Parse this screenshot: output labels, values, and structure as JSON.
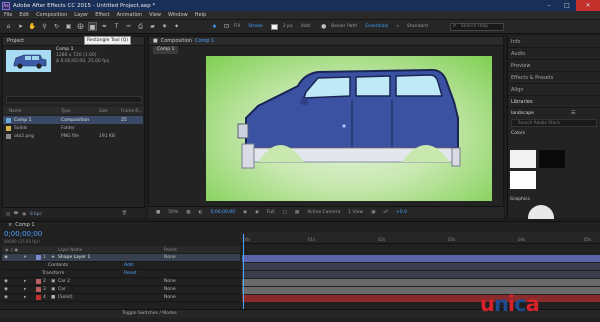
{
  "window": {
    "title": "Adobe After Effects CC 2015 - Untitled Project.aep *",
    "app_icon": "Ae"
  },
  "menu": [
    "File",
    "Edit",
    "Composition",
    "Layer",
    "Effect",
    "Animation",
    "View",
    "Window",
    "Help"
  ],
  "toolbar": {
    "tooltip": "Rectangle Tool (Q)",
    "fill": "Fill",
    "stroke": "Stroke",
    "stroke_width": "2 px",
    "add": "Add:",
    "bezier": "Bezier Path",
    "workspace_essentials": "Essentials",
    "workspace_standard": "Standard",
    "search_placeholder": "Search Help"
  },
  "project": {
    "tab": "Project",
    "selected_name": "Comp 1",
    "selected_info_1": "1280 x 720 (1.00)",
    "selected_info_2": "Δ 0;00;05;00, 25.00 fps",
    "columns": {
      "name": "Name",
      "type": "Type",
      "size": "Size",
      "frame_rate": "Frame R..."
    },
    "items": [
      {
        "name": "Comp 1",
        "type": "Composition",
        "size": "",
        "fps": "25",
        "icon_color": "#6aa9d8",
        "selected": true
      },
      {
        "name": "Solids",
        "type": "Folder",
        "size": "",
        "fps": "",
        "icon_color": "#d8b44a",
        "selected": false
      },
      {
        "name": "oto2.png",
        "type": "PNG file",
        "size": "191 KB",
        "fps": "",
        "icon_color": "#8a8a8a",
        "selected": false
      }
    ],
    "footer_bpc": "8 bpc"
  },
  "composition": {
    "panel_title": "Composition",
    "panel_comp": "Comp 1",
    "tab": "Comp 1",
    "zoom": "50%",
    "timecode": "0;00;00;00",
    "resolution": "Full",
    "camera": "Active Camera",
    "view": "1 View",
    "exposure": "+0.0"
  },
  "right_panels": [
    "Info",
    "Audio",
    "Preview",
    "Effects & Presets",
    "Align",
    "Libraries"
  ],
  "libraries": {
    "library": "landscape",
    "search_placeholder": "Search Adobe Stock"
  },
  "colors_label": "Colors",
  "graphics_label": "Graphics",
  "timeline": {
    "tab": "Comp 1",
    "timecode": "0;00;00;00",
    "fps_line": "00000 (25.00 fps)",
    "columns": {
      "layer_name": "Layer Name",
      "parent": "Parent"
    },
    "contents": "Contents",
    "add_label": "Add:",
    "transform": "Transform",
    "reset": "Reset",
    "ruler": [
      "00s",
      "01s",
      "02s",
      "03s",
      "04s",
      "05s"
    ],
    "toggle": "Toggle Switches / Modes",
    "layers": [
      {
        "num": "1",
        "name": "Shape Layer 1",
        "parent": "None",
        "color": "#7e8ad0",
        "bar": "#5a62a8",
        "selected": true
      },
      {
        "num": "2",
        "name": "Car 2",
        "parent": "None",
        "color": "#b86060",
        "bar": "#6a6a6a",
        "selected": false
      },
      {
        "num": "3",
        "name": "Car",
        "parent": "None",
        "color": "#b86060",
        "bar": "#6a6a6a",
        "selected": false
      },
      {
        "num": "4",
        "name": "[Solid]",
        "parent": "None",
        "color": "#c03030",
        "bar": "#8a2a2a",
        "selected": false
      }
    ]
  },
  "watermark": {
    "u": "u",
    "n": "n",
    "i": "i",
    "c": "c",
    "a": "a"
  }
}
